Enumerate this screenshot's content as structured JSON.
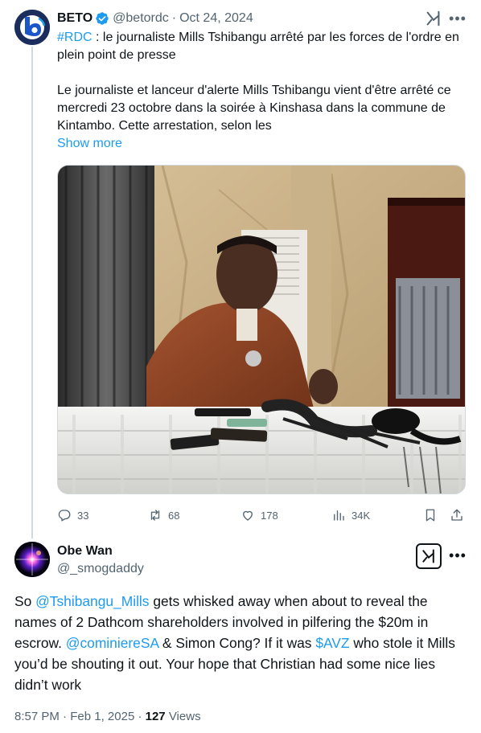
{
  "parent_tweet": {
    "display_name": "BETO",
    "handle": "@betordc",
    "separator": "·",
    "date": "Oct 24, 2024",
    "avatar_icon": "beto-logo-icon",
    "verified_color": "#1d9bf0",
    "hashtag": "#RDC",
    "line1_rest": " : le journaliste Mills Tshibangu arrêté par les forces de l'ordre en plein point de presse",
    "paragraph2": "Le journaliste et lanceur d'alerte Mills Tshibangu vient d'être arrêté ce mercredi 23 octobre dans la soirée à Kinshasa dans la commune de Kintambo. Cette arrestation, selon les",
    "show_more": "Show more",
    "media_icon": "press-conference-photo",
    "stats": {
      "replies": "33",
      "reposts": "68",
      "likes": "178",
      "views": "34K"
    }
  },
  "reply_tweet": {
    "display_name": "Obe Wan",
    "handle": "@_smogdaddy",
    "avatar_icon": "lens-flare-avatar",
    "text_parts": {
      "t1": "So ",
      "m1": "@Tshibangu_Mills",
      "t2": " gets whisked away when about to reveal the names of 2 Dathcom shareholders involved in pilfering the $20m in escrow.  ",
      "m2": "@cominiereSA",
      "t3": " & Simon Cong? If it was ",
      "m3": "$AVZ",
      "t4": " who stole it Mills you’d be shouting it out. Your hope that Christian had some nice lies didn’t work"
    },
    "time": "8:57 PM",
    "separator": "·",
    "date": "Feb 1, 2025",
    "dot2": "·",
    "views_count": "127",
    "views_label": "Views"
  },
  "colors": {
    "accent": "#1d9bf0",
    "text": "#0f1419",
    "muted": "#536471",
    "divider": "#cfd9de"
  }
}
